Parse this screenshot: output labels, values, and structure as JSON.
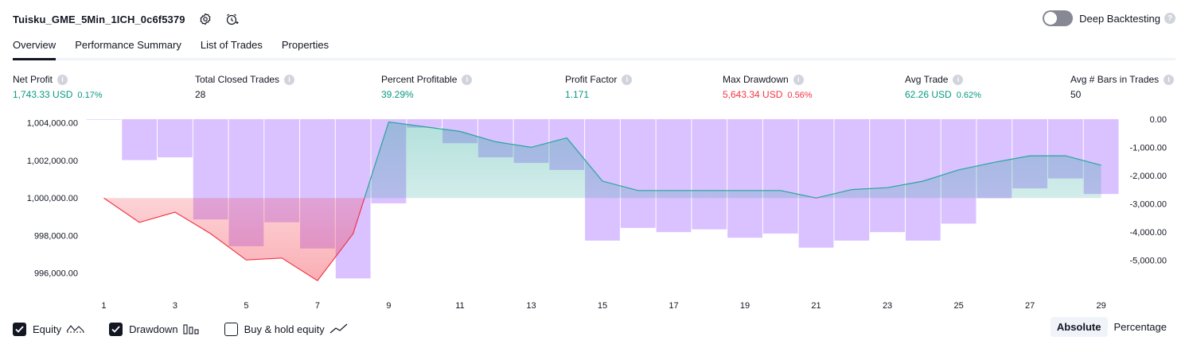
{
  "header": {
    "title": "Tuisku_GME_5Min_1ICH_0c6f5379"
  },
  "deep_backtesting": {
    "label": "Deep Backtesting",
    "enabled": false,
    "help": "?"
  },
  "tabs": [
    {
      "label": "Overview",
      "active": true
    },
    {
      "label": "Performance Summary",
      "active": false
    },
    {
      "label": "List of Trades",
      "active": false
    },
    {
      "label": "Properties",
      "active": false
    }
  ],
  "metrics": [
    {
      "label": "Net Profit",
      "value": "1,743.33 USD",
      "pct": "0.17%",
      "tone": "green"
    },
    {
      "label": "Total Closed Trades",
      "value": "28",
      "pct": "",
      "tone": "neutral"
    },
    {
      "label": "Percent Profitable",
      "value": "39.29%",
      "pct": "",
      "tone": "green"
    },
    {
      "label": "Profit Factor",
      "value": "1.171",
      "pct": "",
      "tone": "green"
    },
    {
      "label": "Max Drawdown",
      "value": "5,643.34 USD",
      "pct": "0.56%",
      "tone": "red"
    },
    {
      "label": "Avg Trade",
      "value": "62.26 USD",
      "pct": "0.62%",
      "tone": "green"
    },
    {
      "label": "Avg # Bars in Trades",
      "value": "50",
      "pct": "",
      "tone": "neutral"
    }
  ],
  "info_glyph": "i",
  "colors": {
    "equity_line_up": "#26a69a",
    "equity_line_down": "#f23645",
    "drawdown_bar": "#c39bff",
    "positive": "#089981",
    "negative": "#f23645"
  },
  "chart_data": {
    "type": "line",
    "baseline": 1000000,
    "x": [
      1,
      2,
      3,
      4,
      5,
      6,
      7,
      8,
      9,
      10,
      11,
      12,
      13,
      14,
      15,
      16,
      17,
      18,
      19,
      20,
      21,
      22,
      23,
      24,
      25,
      26,
      27,
      28,
      29
    ],
    "x_ticks": [
      "1",
      "3",
      "5",
      "7",
      "9",
      "11",
      "13",
      "15",
      "17",
      "19",
      "21",
      "23",
      "25",
      "27",
      "29"
    ],
    "y_left_ticks": [
      "1,004,000.00",
      "1,002,000.00",
      "1,000,000.00",
      "998,000.00",
      "996,000.00"
    ],
    "y_left_tick_values": [
      1004000,
      1002000,
      1000000,
      998000,
      996000
    ],
    "y_right_ticks": [
      "0.00",
      "-1,000.00",
      "-2,000.00",
      "-3,000.00",
      "-4,000.00",
      "-5,000.00"
    ],
    "y_right_tick_values": [
      0,
      -1000,
      -2000,
      -3000,
      -4000,
      -5000
    ],
    "ylim_left": [
      995100,
      1004200
    ],
    "ylim_right": [
      -6050,
      0
    ],
    "series": [
      {
        "name": "Equity",
        "values": [
          1000000,
          998700,
          999250,
          998100,
          996700,
          996800,
          995600,
          998100,
          1004050,
          1003800,
          1003550,
          1003000,
          1002700,
          1003200,
          1000900,
          1000400,
          1000400,
          1000400,
          1000400,
          1000400,
          1000000,
          1000450,
          1000550,
          1000900,
          1001500,
          1001900,
          1002250,
          1002250,
          1001750
        ]
      },
      {
        "name": "Drawdown",
        "values": [
          0,
          -1450,
          -1350,
          -3550,
          -4500,
          -3650,
          -4580,
          -5640,
          -2980,
          -300,
          -850,
          -1350,
          -1550,
          -1800,
          -4300,
          -3850,
          -4000,
          -3900,
          -4200,
          -4050,
          -4550,
          -4300,
          -4000,
          -4300,
          -3700,
          -2800,
          -2450,
          -2100,
          -2650
        ]
      }
    ]
  },
  "legend": [
    {
      "label": "Equity",
      "checked": true,
      "icon": "equity-wave-icon"
    },
    {
      "label": "Drawdown",
      "checked": true,
      "icon": "drawdown-bars-icon"
    },
    {
      "label": "Buy & hold equity",
      "checked": false,
      "icon": "buy-hold-line-icon"
    }
  ],
  "view_mode": {
    "absolute": "Absolute",
    "percentage": "Percentage",
    "selected": "Absolute"
  }
}
